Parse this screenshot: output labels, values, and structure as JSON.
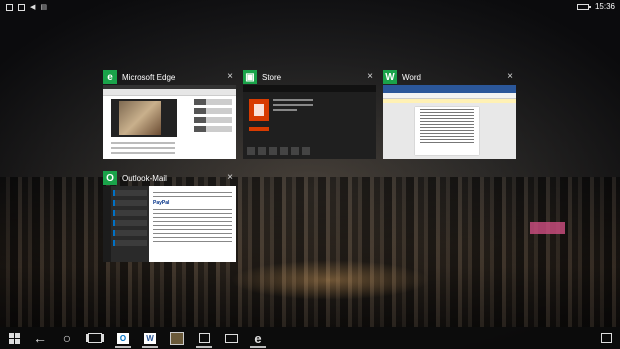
{
  "status_bar": {
    "time": "15:36"
  },
  "windows": [
    {
      "id": "edge",
      "title": "Microsoft Edge",
      "icon": "edge-icon",
      "icon_glyph": "e",
      "accent": "#1aa34a"
    },
    {
      "id": "store",
      "title": "Store",
      "icon": "store-icon",
      "icon_glyph": "▣",
      "accent": "#1aa34a"
    },
    {
      "id": "word",
      "title": "Word",
      "icon": "word-icon",
      "icon_glyph": "W",
      "accent": "#1aa34a"
    },
    {
      "id": "outlook",
      "title": "Outlook-Mail",
      "icon": "outlook-mail-icon",
      "icon_glyph": "O",
      "accent": "#1aa34a"
    }
  ],
  "close_glyph": "×",
  "taskbar": {
    "items": [
      {
        "name": "start-button",
        "glyph": "windows-logo"
      },
      {
        "name": "back-button",
        "glyph": "←"
      },
      {
        "name": "search-button",
        "glyph": "○"
      },
      {
        "name": "task-view-button",
        "glyph": "task-view"
      },
      {
        "name": "taskbar-outlook",
        "glyph": "O"
      },
      {
        "name": "taskbar-word",
        "glyph": "W"
      },
      {
        "name": "taskbar-app",
        "glyph": "app"
      },
      {
        "name": "taskbar-store",
        "glyph": "store"
      },
      {
        "name": "taskbar-file-explorer",
        "glyph": "folder"
      },
      {
        "name": "taskbar-edge",
        "glyph": "e"
      },
      {
        "name": "action-center-button",
        "glyph": "notification"
      }
    ]
  }
}
